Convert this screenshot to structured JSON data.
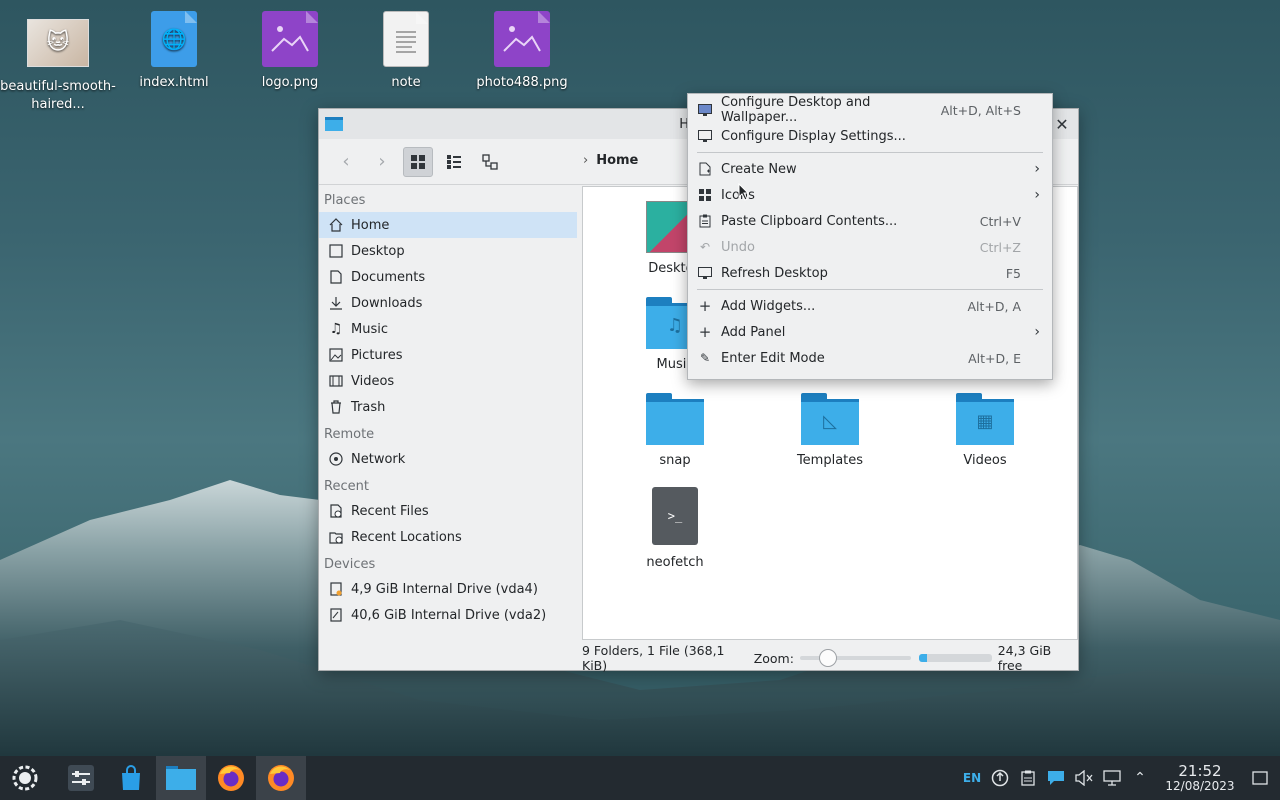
{
  "desktop": {
    "icons": [
      {
        "label": "beautiful-smooth-haired...",
        "icon": "image-thumbnail-cat"
      },
      {
        "label": "index.html",
        "icon": "html-file-icon"
      },
      {
        "label": "logo.png",
        "icon": "image-file-icon"
      },
      {
        "label": "note",
        "icon": "text-file-icon"
      },
      {
        "label": "photo488.png",
        "icon": "image-file-icon"
      }
    ]
  },
  "file_manager": {
    "title": "Home",
    "breadcrumb": "Home",
    "sidebar": {
      "sections": [
        "Places",
        "Remote",
        "Recent",
        "Devices"
      ],
      "places": [
        "Home",
        "Desktop",
        "Documents",
        "Downloads",
        "Music",
        "Pictures",
        "Videos",
        "Trash"
      ],
      "remote": [
        "Network"
      ],
      "recent": [
        "Recent Files",
        "Recent Locations"
      ],
      "devices": [
        "4,9 GiB Internal Drive (vda4)",
        "40,6 GiB Internal Drive (vda2)"
      ]
    },
    "items": [
      "Desktop",
      "Music",
      "snap",
      "Templates",
      "Videos",
      "neofetch"
    ],
    "status": {
      "summary": "9 Folders, 1 File (368,1 KiB)",
      "zoom_label": "Zoom:",
      "zoom_level": 0.2,
      "free_space": "24,3 GiB free",
      "free_fraction": 0.1
    }
  },
  "context_menu": {
    "items": [
      {
        "label": "Configure Desktop and Wallpaper...",
        "shortcut": "Alt+D, Alt+S",
        "icon": "wallpaper-icon"
      },
      {
        "label": "Configure Display Settings...",
        "shortcut": "",
        "icon": "display-icon"
      },
      {
        "label": "Create New",
        "shortcut": "",
        "icon": "new-file-icon",
        "submenu": true
      },
      {
        "label": "Icons",
        "shortcut": "",
        "icon": "icons-grid-icon",
        "submenu": true
      },
      {
        "label": "Paste Clipboard Contents...",
        "shortcut": "Ctrl+V",
        "icon": "paste-icon"
      },
      {
        "label": "Undo",
        "shortcut": "Ctrl+Z",
        "icon": "undo-icon",
        "disabled": true
      },
      {
        "label": "Refresh Desktop",
        "shortcut": "F5",
        "icon": "refresh-icon"
      },
      {
        "label": "Add Widgets...",
        "shortcut": "Alt+D, A",
        "icon": "plus-icon"
      },
      {
        "label": "Add Panel",
        "shortcut": "",
        "icon": "plus-icon",
        "submenu": true
      },
      {
        "label": "Enter Edit Mode",
        "shortcut": "Alt+D, E",
        "icon": "edit-icon"
      }
    ]
  },
  "taskbar": {
    "language": "EN",
    "time": "21:52",
    "date": "12/08/2023"
  },
  "colors": {
    "accent": "#3daee9",
    "selection": "#cfe3f6",
    "taskbar": "#232a30"
  }
}
